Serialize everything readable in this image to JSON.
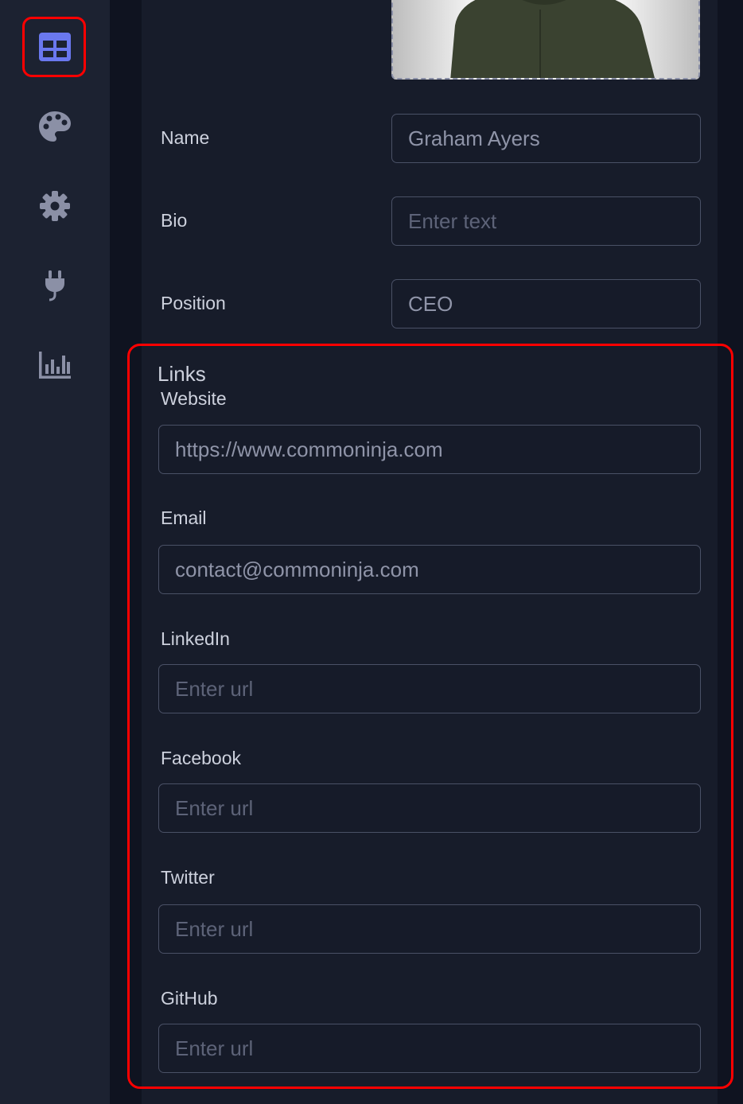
{
  "sidebar": {
    "items": [
      {
        "icon": "layout-icon",
        "active": true
      },
      {
        "icon": "palette-icon",
        "active": false
      },
      {
        "icon": "gear-icon",
        "active": false
      },
      {
        "icon": "plug-icon",
        "active": false
      },
      {
        "icon": "analytics-chart-icon",
        "active": false
      }
    ]
  },
  "profile": {
    "name_label": "Name",
    "name_value": "Graham Ayers",
    "bio_label": "Bio",
    "bio_value": "",
    "bio_placeholder": "Enter text",
    "position_label": "Position",
    "position_value": "CEO"
  },
  "links": {
    "title": "Links",
    "website_label": "Website",
    "website_value": "https://www.commoninja.com",
    "email_label": "Email",
    "email_value": "contact@commoninja.com",
    "linkedin_label": "LinkedIn",
    "linkedin_placeholder": "Enter url",
    "facebook_label": "Facebook",
    "facebook_placeholder": "Enter url",
    "twitter_label": "Twitter",
    "twitter_placeholder": "Enter url",
    "github_label": "GitHub",
    "github_placeholder": "Enter url"
  },
  "colors": {
    "accent": "#6a78ef",
    "highlight": "#ff0000",
    "panel": "#171c2a",
    "sidebar": "#1c2231"
  }
}
